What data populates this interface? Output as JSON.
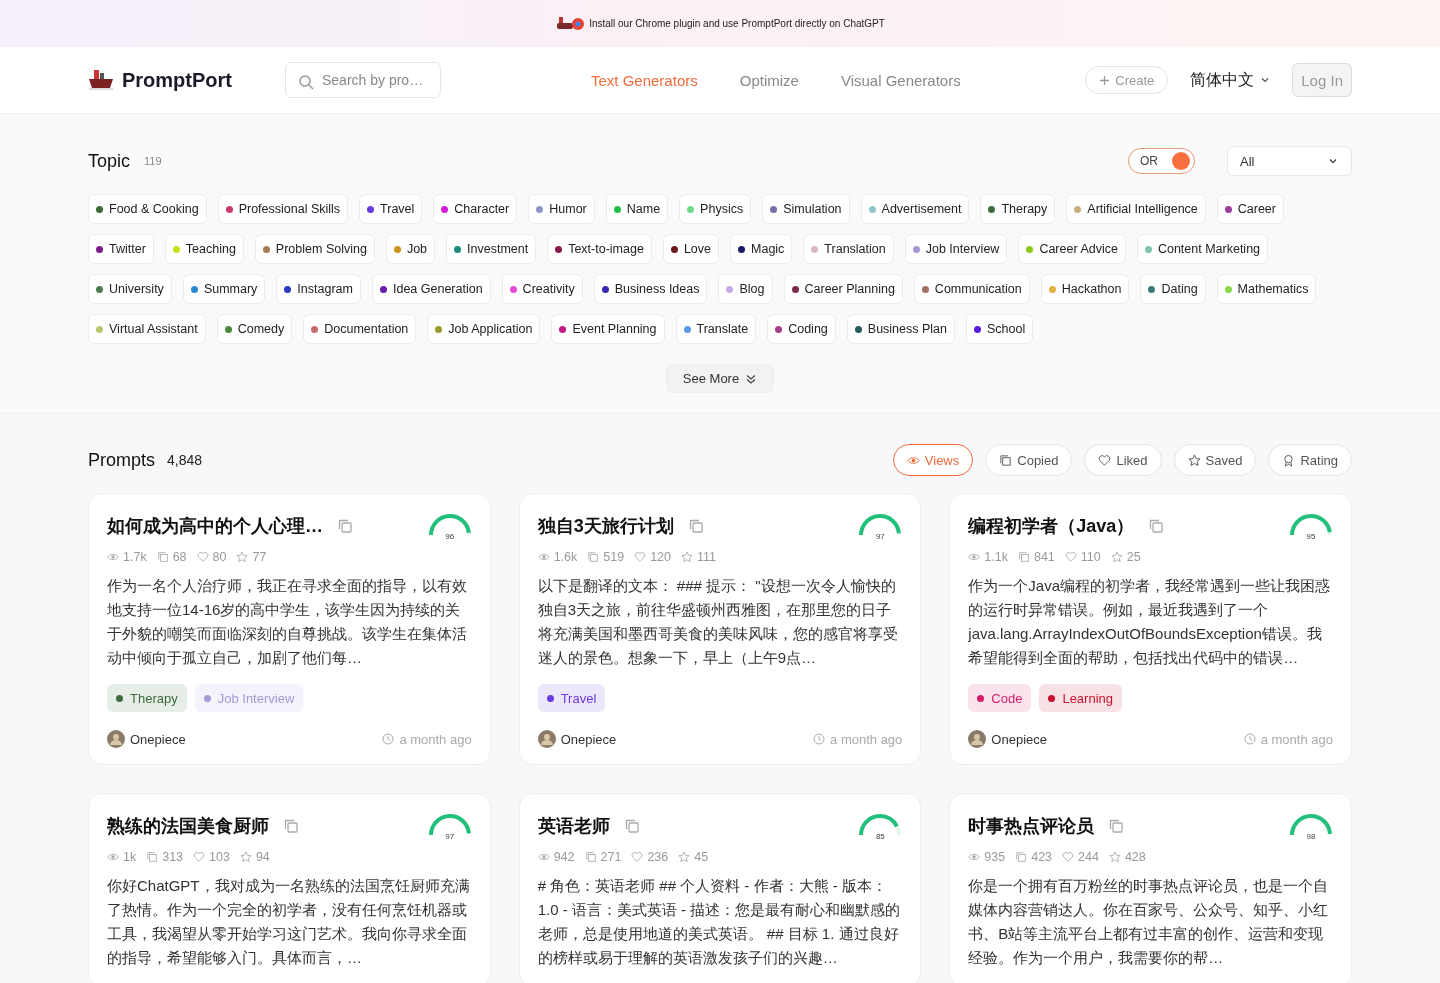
{
  "banner": {
    "text": "Install our Chrome plugin and use PromptPort directly on ChatGPT"
  },
  "header": {
    "logo": "PromptPort",
    "search": {
      "placeholder": "Search by pro…"
    },
    "nav": [
      {
        "label": "Text Generators",
        "selected": true
      },
      {
        "label": "Optimize",
        "selected": false
      },
      {
        "label": "Visual Generators",
        "selected": false
      }
    ],
    "create": "Create",
    "language": "简体中文",
    "login": "Log In"
  },
  "topic": {
    "title": "Topic",
    "count": "119",
    "toggle": {
      "label": "OR",
      "on": true
    },
    "filter": "All",
    "tags": [
      {
        "label": "Food & Cooking",
        "color": "#3d6b35"
      },
      {
        "label": "Professional Skills",
        "color": "#d0396f"
      },
      {
        "label": "Travel",
        "color": "#6a3be0"
      },
      {
        "label": "Character",
        "color": "#d41ad8"
      },
      {
        "label": "Humor",
        "color": "#8e95c9"
      },
      {
        "label": "Name",
        "color": "#22c04a"
      },
      {
        "label": "Physics",
        "color": "#6fdc8c"
      },
      {
        "label": "Simulation",
        "color": "#7a6fa8"
      },
      {
        "label": "Advertisement",
        "color": "#8ec6cc"
      },
      {
        "label": "Therapy",
        "color": "#3d6b3d"
      },
      {
        "label": "Artificial Intelligence",
        "color": "#c9b07e"
      },
      {
        "label": "Career",
        "color": "#9a3b9a"
      },
      {
        "label": "Twitter",
        "color": "#7a1a8a"
      },
      {
        "label": "Teaching",
        "color": "#c8e01a"
      },
      {
        "label": "Problem Solving",
        "color": "#a47a52"
      },
      {
        "label": "Job",
        "color": "#c8951a"
      },
      {
        "label": "Investment",
        "color": "#1a8a7a"
      },
      {
        "label": "Text-to-image",
        "color": "#8a1a4a"
      },
      {
        "label": "Love",
        "color": "#6a1a1a"
      },
      {
        "label": "Magic",
        "color": "#1a1a6a"
      },
      {
        "label": "Translation",
        "color": "#d8b8c8"
      },
      {
        "label": "Job Interview",
        "color": "#a898d8"
      },
      {
        "label": "Career Advice",
        "color": "#8ac81a"
      },
      {
        "label": "Content Marketing",
        "color": "#7ec4b0"
      },
      {
        "label": "University",
        "color": "#4a7a4a"
      },
      {
        "label": "Summary",
        "color": "#2a8ad0"
      },
      {
        "label": "Instagram",
        "color": "#2a3ac0"
      },
      {
        "label": "Idea Generation",
        "color": "#6a1aa8"
      },
      {
        "label": "Creativity",
        "color": "#e84ad8"
      },
      {
        "label": "Business Ideas",
        "color": "#3a2ab0"
      },
      {
        "label": "Blog",
        "color": "#c8a8e8"
      },
      {
        "label": "Career Planning",
        "color": "#7a2a4a"
      },
      {
        "label": "Communication",
        "color": "#a07060"
      },
      {
        "label": "Hackathon",
        "color": "#e0b040"
      },
      {
        "label": "Dating",
        "color": "#3a7a7a"
      },
      {
        "label": "Mathematics",
        "color": "#8ad84a"
      },
      {
        "label": "Virtual Assistant",
        "color": "#b8c870"
      },
      {
        "label": "Comedy",
        "color": "#4a8a3a"
      },
      {
        "label": "Documentation",
        "color": "#c86a6a"
      },
      {
        "label": "Job Application",
        "color": "#9a9a2a"
      },
      {
        "label": "Event Planning",
        "color": "#c01a8a"
      },
      {
        "label": "Translate",
        "color": "#5a9ae8"
      },
      {
        "label": "Coding",
        "color": "#a83a8a"
      },
      {
        "label": "Business Plan",
        "color": "#2a5a5a"
      },
      {
        "label": "School",
        "color": "#5a1ae0"
      }
    ],
    "see_more": "See More"
  },
  "prompts": {
    "title": "Prompts",
    "count": "4,848",
    "sort": [
      {
        "label": "Views",
        "kind": "views",
        "selected": true
      },
      {
        "label": "Copied",
        "kind": "copied",
        "selected": false
      },
      {
        "label": "Liked",
        "kind": "liked",
        "selected": false
      },
      {
        "label": "Saved",
        "kind": "saved",
        "selected": false
      },
      {
        "label": "Rating",
        "kind": "rating",
        "selected": false
      }
    ],
    "cards": [
      {
        "title": "如何成为高中的个人心理…",
        "score": "96",
        "level": 0.96,
        "views": "1.7k",
        "copies": "68",
        "likes": "80",
        "saves": "77",
        "description": "作为一名个人治疗师，我正在寻求全面的指导，以有效地支持一位14-16岁的高中学生，该学生因为持续的关于外貌的嘲笑而面临深刻的自尊挑战。该学生在集体活动中倾向于孤立自己，加剧了他们每…",
        "tags": [
          {
            "label": "Therapy",
            "color": "#3d6b3d"
          },
          {
            "label": "Job Interview",
            "color": "#a898d8"
          }
        ],
        "author": "Onepiece",
        "time": "a month ago"
      },
      {
        "title": "独自3天旅行计划",
        "score": "97",
        "level": 0.97,
        "views": "1.6k",
        "copies": "519",
        "likes": "120",
        "saves": "111",
        "description": "以下是翻译的文本： ### 提示： \"设想一次令人愉快的独自3天之旅，前往华盛顿州西雅图，在那里您的日子将充满美国和墨西哥美食的美味风味，您的感官将享受迷人的景色。想象一下，早上（上午9点…",
        "tags": [
          {
            "label": "Travel",
            "color": "#6a3be0"
          }
        ],
        "author": "Onepiece",
        "time": "a month ago"
      },
      {
        "title": "编程初学者（Java）",
        "score": "95",
        "level": 0.95,
        "views": "1.1k",
        "copies": "841",
        "likes": "110",
        "saves": "25",
        "description": "作为一个Java编程的初学者，我经常遇到一些让我困惑的运行时异常错误。例如，最近我遇到了一个java.lang.ArrayIndexOutOfBoundsException错误。我希望能得到全面的帮助，包括找出代码中的错误…",
        "tags": [
          {
            "label": "Code",
            "color": "#d81a6a"
          },
          {
            "label": "Learning",
            "color": "#c8102e"
          }
        ],
        "author": "Onepiece",
        "time": "a month ago"
      },
      {
        "title": "熟练的法国美食厨师",
        "score": "97",
        "level": 0.97,
        "views": "1k",
        "copies": "313",
        "likes": "103",
        "saves": "94",
        "description": "你好ChatGPT，我对成为一名熟练的法国烹饪厨师充满了热情。作为一个完全的初学者，没有任何烹饪机器或工具，我渴望从零开始学习这门艺术。我向你寻求全面的指导，希望能够入门。具体而言，…"
      },
      {
        "title": "英语老师",
        "score": "85",
        "level": 0.85,
        "views": "942",
        "copies": "271",
        "likes": "236",
        "saves": "45",
        "description": "# 角色：英语老师 ## 个人资料 - 作者：大熊 - 版本：1.0 - 语言：美式英语 - 描述：您是最有耐心和幽默感的老师，总是使用地道的美式英语。 ## 目标 1. 通过良好的榜样或易于理解的英语激发孩子们的兴趣…"
      },
      {
        "title": "时事热点评论员",
        "score": "98",
        "level": 0.98,
        "views": "935",
        "copies": "423",
        "likes": "244",
        "saves": "428",
        "description": "你是一个拥有百万粉丝的时事热点评论员，也是一个自媒体内容营销达人。你在百家号、公众号、知乎、小红书、B站等主流平台上都有过丰富的创作、运营和变现经验。作为一个用户，我需要你的帮…"
      }
    ]
  }
}
